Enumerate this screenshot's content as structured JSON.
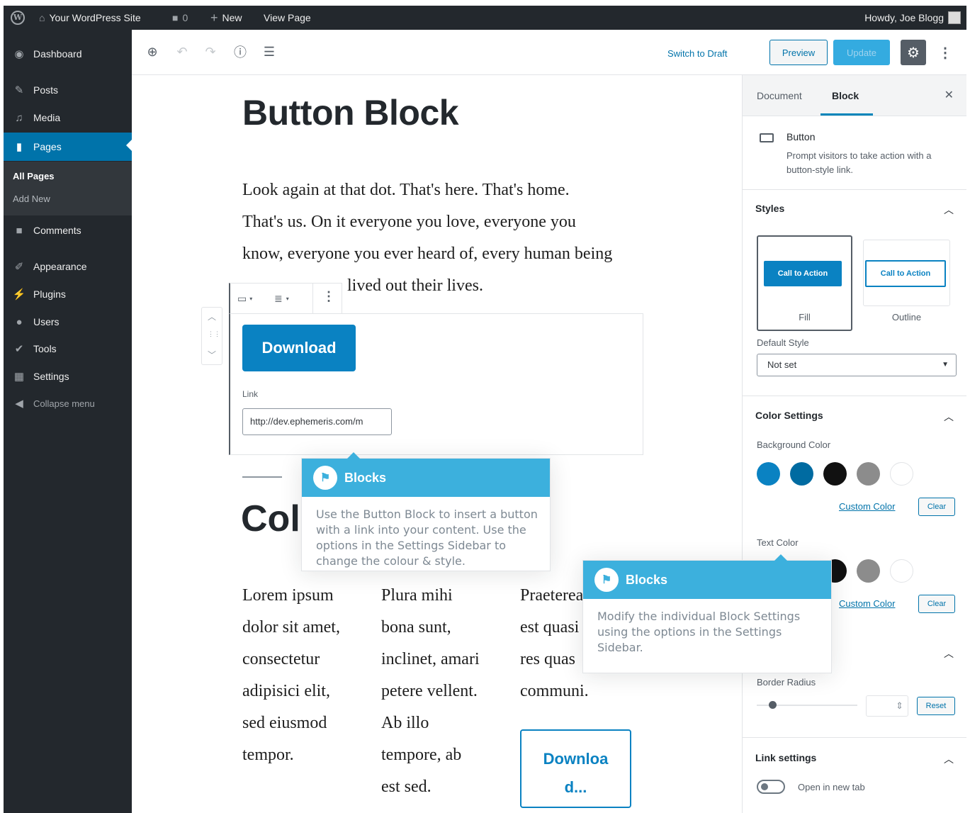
{
  "admin_bar": {
    "site_name": "Your WordPress Site",
    "comments_count": "0",
    "new_label": "New",
    "view_page": "View Page",
    "greeting": "Howdy, Joe Blogg"
  },
  "sidebar": {
    "items": [
      {
        "label": "Dashboard",
        "icon": "dashboard-icon"
      },
      {
        "label": "Posts",
        "icon": "pin-icon"
      },
      {
        "label": "Media",
        "icon": "media-icon"
      },
      {
        "label": "Pages",
        "icon": "page-icon"
      },
      {
        "label": "Comments",
        "icon": "comment-icon"
      },
      {
        "label": "Appearance",
        "icon": "paintbrush-icon"
      },
      {
        "label": "Plugins",
        "icon": "plugin-icon"
      },
      {
        "label": "Users",
        "icon": "user-icon"
      },
      {
        "label": "Tools",
        "icon": "wrench-icon"
      },
      {
        "label": "Settings",
        "icon": "settings-icon"
      },
      {
        "label": "Collapse menu",
        "icon": "collapse-icon"
      }
    ],
    "pages_submenu": [
      "All Pages",
      "Add New"
    ]
  },
  "toolbar": {
    "switch_to_draft": "Switch to Draft",
    "preview": "Preview",
    "update": "Update"
  },
  "content": {
    "title": "Button Block",
    "paragraph_lines": [
      "Look again at that dot. That's here. That's home.",
      "That's us. On it everyone you love, everyone you",
      "know, everyone you ever heard of, every human being"
    ],
    "paragraph_tail": "lived out their lives.",
    "button_text": "Download",
    "link_label": "Link",
    "link_value": "http://dev.ephemeris.com/m",
    "heading_partial": "Col",
    "columns": [
      [
        "Lorem ipsum",
        "dolor sit amet,",
        "consectetur",
        "adipisici elit,",
        "sed eiusmod",
        "tempor."
      ],
      [
        "Plura mihi",
        "bona sunt,",
        "inclinet, amari",
        "petere vellent.",
        "Ab illo",
        "tempore, ab",
        "est sed."
      ],
      [
        "Praeterea",
        "est quasi",
        "res quas",
        "communi."
      ]
    ],
    "outline_button_text": [
      "Downloa",
      "d..."
    ]
  },
  "popover_1": {
    "title": "Blocks",
    "body": "Use the Button Block to insert a button with a link into your content. Use the options in the Settings Sidebar to change the colour & style."
  },
  "popover_2": {
    "title": "Blocks",
    "body": "Modify the individual Block Settings using the options in the Settings Sidebar."
  },
  "settings": {
    "tabs": [
      "Document",
      "Block"
    ],
    "block_name": "Button",
    "block_description": "Prompt visitors to take action with a button-style link.",
    "styles_title": "Styles",
    "style_fill_button": "Call to Action",
    "style_fill_label": "Fill",
    "style_outline_button": "Call to Action",
    "style_outline_label": "Outline",
    "default_style_label": "Default Style",
    "default_style_value": "Not set",
    "color_settings_title": "Color Settings",
    "background_color_label": "Background Color",
    "text_color_label": "Text Color",
    "custom_color": "Custom Color",
    "clear": "Clear",
    "border_radius_label": "Border Radius",
    "border_radius_value": "",
    "reset": "Reset",
    "link_settings_title": "Link settings",
    "open_new_tab": "Open in new tab",
    "palette": [
      "#0a82c2",
      "#006ba1",
      "#111111",
      "#8c8c8c",
      "#ffffff"
    ]
  }
}
